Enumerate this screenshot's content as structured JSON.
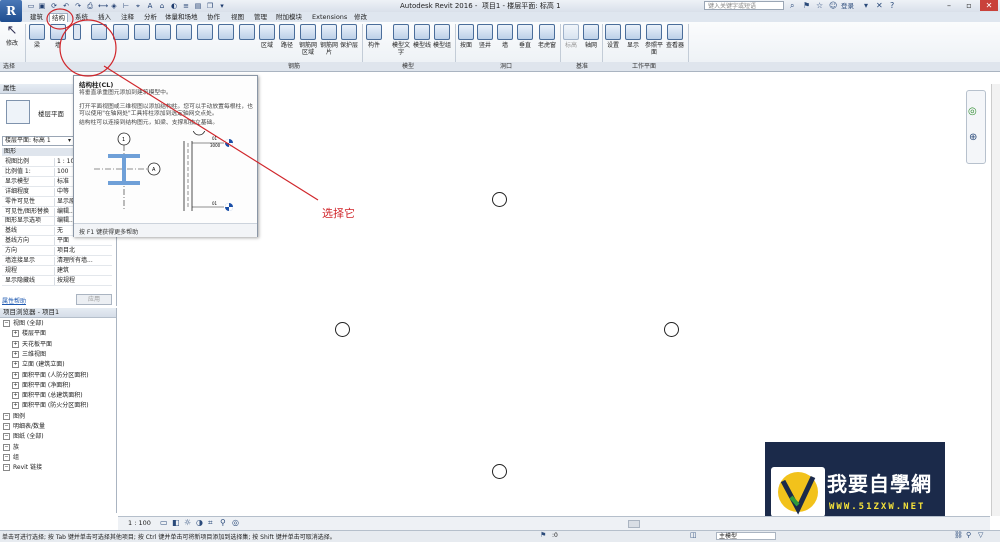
{
  "app": {
    "logo_letter": "R",
    "window_title": "Autodesk Revit 2016 -",
    "document_title": "项目1 - 楼层平面: 标高 1",
    "search_placeholder": "键入关键字或短语",
    "login_label": "登录"
  },
  "tabs": [
    "建筑",
    "结构",
    "系统",
    "插入",
    "注释",
    "分析",
    "体量和场地",
    "协作",
    "视图",
    "管理",
    "附加模块",
    "Extensions",
    "修改"
  ],
  "active_tab": "结构",
  "ribbon": {
    "modify_label": "修改",
    "buttons": [
      {
        "label": "梁"
      },
      {
        "label": "墙"
      },
      {
        "label": ""
      },
      {
        "label": ""
      },
      {
        "label": ""
      },
      {
        "label": "区域"
      },
      {
        "label": "路径"
      },
      {
        "label": "钢筋网区域"
      },
      {
        "label": "钢筋网片"
      },
      {
        "label": "保护层"
      },
      {
        "label": "构件"
      },
      {
        "label": "模型文字"
      },
      {
        "label": "模型线"
      },
      {
        "label": "模型组"
      },
      {
        "label": "按面"
      },
      {
        "label": "竖井"
      },
      {
        "label": "墙"
      },
      {
        "label": "垂直"
      },
      {
        "label": "老虎窗"
      },
      {
        "label": "标高"
      },
      {
        "label": "轴网"
      },
      {
        "label": "设置"
      },
      {
        "label": "显示"
      },
      {
        "label": "参照平面"
      },
      {
        "label": "查看器"
      }
    ],
    "panels": [
      "选择",
      "钢筋",
      "模型",
      "洞口",
      "基准",
      "工作平面"
    ]
  },
  "tooltip": {
    "title": "结构柱(CL)",
    "desc1": "将垂直承重图元添加到建筑模型中。",
    "desc2": "打开平面视图或三维视图以添加结构柱。您可以手动放置每根柱，也可以使用\"在轴网处\"工具将柱添加到选定轴网交点处。",
    "desc3": "结构柱可以连接到结构图元，如梁、支撑和独立基础。",
    "footer": "按 F1 键获得更多帮助",
    "diagram_labels": [
      "1",
      "A",
      "1",
      "01",
      "3000",
      "01"
    ]
  },
  "annotation": {
    "text": "选择它",
    "color": "#d0262b"
  },
  "properties": {
    "header": "属性",
    "type_name": "楼层平面",
    "view_selector": "楼层平面: 标高 1",
    "edit_type": "编辑类型",
    "section": "图形",
    "rows": [
      {
        "k": "视图比例",
        "v": "1 : 100"
      },
      {
        "k": "比例值 1:",
        "v": "100"
      },
      {
        "k": "显示模型",
        "v": "标准"
      },
      {
        "k": "详细程度",
        "v": "中等"
      },
      {
        "k": "零件可见性",
        "v": "显示原状态"
      },
      {
        "k": "可见性/图形替换",
        "v": "编辑..."
      },
      {
        "k": "图形显示选项",
        "v": "编辑..."
      },
      {
        "k": "基线",
        "v": "无"
      },
      {
        "k": "基线方向",
        "v": "平面"
      },
      {
        "k": "方向",
        "v": "项目北"
      },
      {
        "k": "墙连接显示",
        "v": "清理所有墙..."
      },
      {
        "k": "规程",
        "v": "建筑"
      },
      {
        "k": "显示隐藏线",
        "v": "按规程"
      }
    ],
    "help_link": "属性帮助",
    "apply_button": "应用"
  },
  "project_browser": {
    "header": "项目浏览器 - 项目1",
    "items": [
      {
        "label": "视图 (全部)",
        "level": 0
      },
      {
        "label": "楼层平面",
        "level": 1
      },
      {
        "label": "天花板平面",
        "level": 1
      },
      {
        "label": "三维视图",
        "level": 1
      },
      {
        "label": "立面 (建筑立面)",
        "level": 1
      },
      {
        "label": "面积平面 (人防分区面积)",
        "level": 1
      },
      {
        "label": "面积平面 (净面积)",
        "level": 1
      },
      {
        "label": "面积平面 (总建筑面积)",
        "level": 1
      },
      {
        "label": "面积平面 (防火分区面积)",
        "level": 1
      },
      {
        "label": "图例",
        "level": 0
      },
      {
        "label": "明细表/数量",
        "level": 0
      },
      {
        "label": "图纸 (全部)",
        "level": 0
      },
      {
        "label": "族",
        "level": 0
      },
      {
        "label": "组",
        "level": 0
      },
      {
        "label": "Revit 链接",
        "level": 0
      }
    ]
  },
  "view_control_bar": {
    "scale": "1 : 100"
  },
  "status": {
    "message": "单击可进行选择; 按 Tab 键并单击可选择其他项目; 按 Ctrl 键并单击可将新项目添加到选择集; 按 Shift 键并单击可取消选择。",
    "coord": ":0",
    "model_label": "主模型"
  },
  "watermark": {
    "cn": "我要自學網",
    "url": "WWW.51ZXW.NET"
  }
}
